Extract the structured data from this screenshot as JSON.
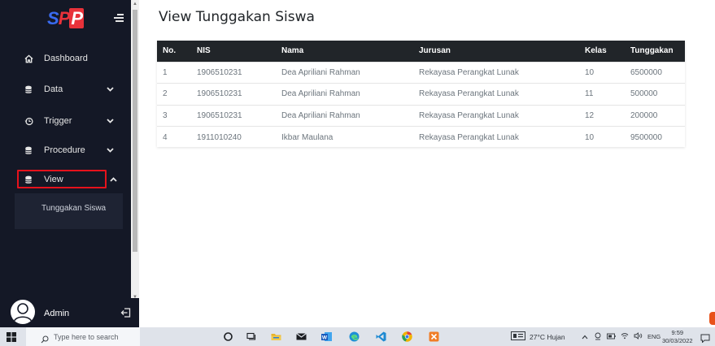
{
  "sidebar": {
    "logo_parts": [
      "S",
      "P",
      "P"
    ],
    "nav": [
      {
        "id": "dashboard",
        "label": "Dashboard",
        "icon": "home-icon",
        "chevron": ""
      },
      {
        "id": "data",
        "label": "Data",
        "icon": "database-icon",
        "chevron": "down"
      },
      {
        "id": "trigger",
        "label": "Trigger",
        "icon": "history-icon",
        "chevron": "down"
      },
      {
        "id": "procedure",
        "label": "Procedure",
        "icon": "database-icon",
        "chevron": "down"
      },
      {
        "id": "view",
        "label": "View",
        "icon": "database-icon",
        "chevron": "up",
        "active": true
      }
    ],
    "submenu_item": "Tunggakan Siswa",
    "user_name": "Admin"
  },
  "main": {
    "title": "View Tunggakan Siswa",
    "table": {
      "headers": [
        "No.",
        "NIS",
        "Nama",
        "Jurusan",
        "Kelas",
        "Tunggakan"
      ],
      "rows": [
        [
          "1",
          "1906510231",
          "Dea Apriliani Rahman",
          "Rekayasa Perangkat Lunak",
          "10",
          "6500000"
        ],
        [
          "2",
          "1906510231",
          "Dea Apriliani Rahman",
          "Rekayasa Perangkat Lunak",
          "11",
          "500000"
        ],
        [
          "3",
          "1906510231",
          "Dea Apriliani Rahman",
          "Rekayasa Perangkat Lunak",
          "12",
          "200000"
        ],
        [
          "4",
          "1911010240",
          "Ikbar Maulana",
          "Rekayasa Perangkat Lunak",
          "10",
          "9500000"
        ]
      ]
    }
  },
  "taskbar": {
    "search_placeholder": "Type here to search",
    "weather": "27°C  Hujan",
    "language": "ENG",
    "time": "9:59",
    "date": "30/03/2022"
  },
  "colors": {
    "sidebar_bg": "#141826",
    "highlight_border": "#e5121c",
    "table_header_bg": "#212529"
  }
}
